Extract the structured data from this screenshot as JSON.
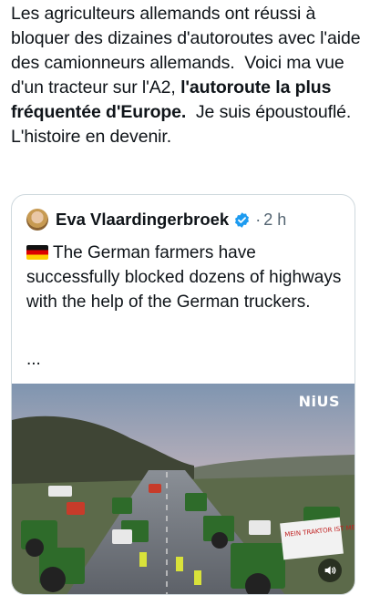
{
  "post": {
    "text_segments": [
      {
        "text": "Les agriculteurs allemands ont réussi à bloquer des dizaines d'autoroutes avec l'aide des camionneurs allemands.  Voici ma vue d'un tracteur sur l'A2, ",
        "bold": false
      },
      {
        "text": "l'autoroute la plus fréquentée d'Europe.",
        "bold": true
      },
      {
        "text": "  Je suis époustouflé. L'histoire en devenir.",
        "bold": false
      }
    ]
  },
  "quote": {
    "author_name": "Eva Vlaardingerbroek",
    "verified": true,
    "separator": "·",
    "timestamp": "2 h",
    "flag_icon": "german-flag-icon",
    "text": "The German farmers have successfully blocked dozens of highways with the help of the German truckers.",
    "truncation": "...",
    "media": {
      "type": "video",
      "brand_logo": "NiUS",
      "sign_text": "MEIN TRAKTOR IST MEIN PROTEST",
      "mute_icon": "speaker-icon"
    }
  },
  "colors": {
    "text": "#0f1419",
    "secondary": "#536471",
    "border": "#cfd9de",
    "verified": "#1d9bf0",
    "nius": "#f2b21a"
  }
}
